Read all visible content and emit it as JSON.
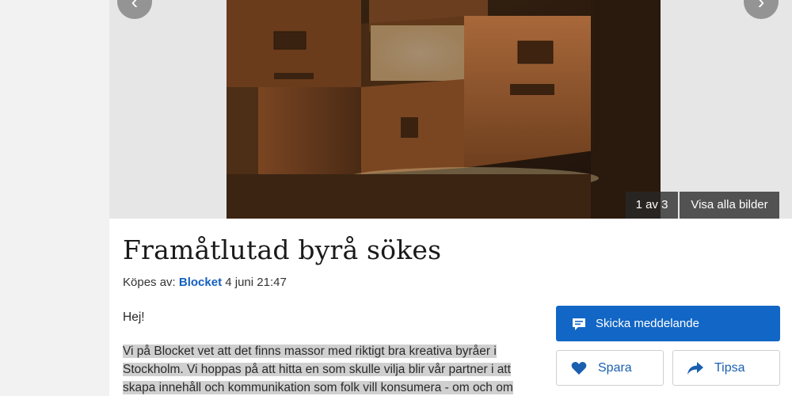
{
  "gallery": {
    "prev_arrow": "‹",
    "next_arrow": "›",
    "counter": "1 av 3",
    "show_all_label": "Visa alla bilder"
  },
  "ad": {
    "title": "Framåtlutad byrå sökes",
    "meta_prefix": "Köpes av:",
    "seller": "Blocket",
    "date": "4 juni 21:47",
    "greeting": "Hej!",
    "body_lines": [
      "Vi på Blocket vet att det finns massor med riktigt bra kreativa byråer i",
      "Stockholm. Vi hoppas på att hitta en som skulle vilja blir vår partner i att",
      "skapa innehåll och kommunikation som folk vill konsumera - om och om"
    ]
  },
  "actions": {
    "message_label": "Skicka meddelande",
    "save_label": "Spara",
    "tips_label": "Tipsa"
  },
  "colors": {
    "accent_blue": "#1266c5",
    "link_blue": "#1460c0",
    "highlight": "#d0d0d0"
  },
  "icons": {
    "message": "chat-bubble-icon",
    "save": "heart-icon",
    "tips": "share-arrow-icon"
  }
}
